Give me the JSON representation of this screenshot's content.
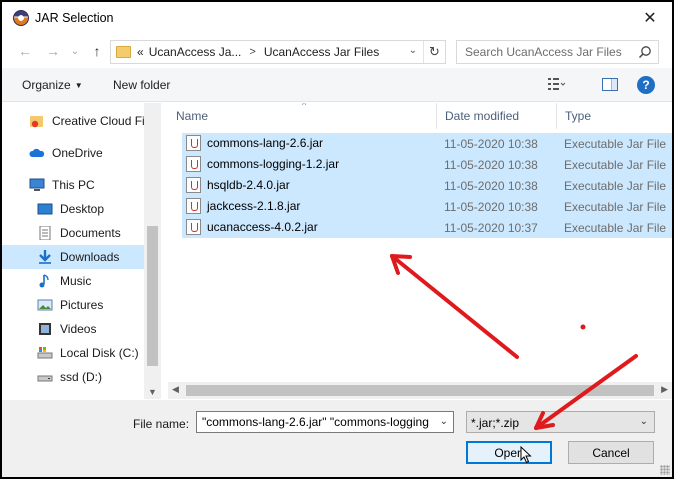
{
  "window": {
    "title": "JAR Selection",
    "app_icon": "eclipse-icon",
    "close_glyph": "✕"
  },
  "nav": {
    "back_glyph": "←",
    "forward_glyph": "→",
    "recent_glyph": "⌄",
    "up_glyph": "↑",
    "breadcrumb": [
      "«",
      "UcanAccess Ja...",
      "UcanAccess Jar Files"
    ],
    "search_placeholder": "Search UcanAccess Jar Files"
  },
  "toolbar": {
    "organize_label": "Organize",
    "new_folder_label": "New folder",
    "help_glyph": "?"
  },
  "sidebar": {
    "items": [
      {
        "label": "Creative Cloud Fil",
        "icon": "creative-cloud-icon"
      },
      {
        "label": "OneDrive",
        "icon": "onedrive-icon"
      },
      {
        "label": "This PC",
        "icon": "this-pc-icon"
      },
      {
        "label": "Desktop",
        "icon": "desktop-icon"
      },
      {
        "label": "Documents",
        "icon": "documents-icon"
      },
      {
        "label": "Downloads",
        "icon": "downloads-icon",
        "selected": true
      },
      {
        "label": "Music",
        "icon": "music-icon"
      },
      {
        "label": "Pictures",
        "icon": "pictures-icon"
      },
      {
        "label": "Videos",
        "icon": "videos-icon"
      },
      {
        "label": "Local Disk (C:)",
        "icon": "local-disk-icon"
      },
      {
        "label": "ssd (D:)",
        "icon": "drive-icon"
      }
    ]
  },
  "file_list": {
    "columns": {
      "name": "Name",
      "date": "Date modified",
      "type": "Type"
    },
    "rows": [
      {
        "name": "commons-lang-2.6.jar",
        "date": "11-05-2020 10:38",
        "type": "Executable Jar File"
      },
      {
        "name": "commons-logging-1.2.jar",
        "date": "11-05-2020 10:38",
        "type": "Executable Jar File"
      },
      {
        "name": "hsqldb-2.4.0.jar",
        "date": "11-05-2020 10:38",
        "type": "Executable Jar File"
      },
      {
        "name": "jackcess-2.1.8.jar",
        "date": "11-05-2020 10:38",
        "type": "Executable Jar File"
      },
      {
        "name": "ucanaccess-4.0.2.jar",
        "date": "11-05-2020 10:37",
        "type": "Executable Jar File"
      }
    ]
  },
  "footer": {
    "file_name_label": "File name:",
    "file_name_value": "\"commons-lang-2.6.jar\" \"commons-logging",
    "filter_value": "*.jar;*.zip",
    "open_label": "Open",
    "cancel_label": "Cancel"
  },
  "annotation": {
    "arrow_color": "#e0191d"
  },
  "colors": {
    "selection": "#cce8ff",
    "primary_border": "#0078d7"
  }
}
